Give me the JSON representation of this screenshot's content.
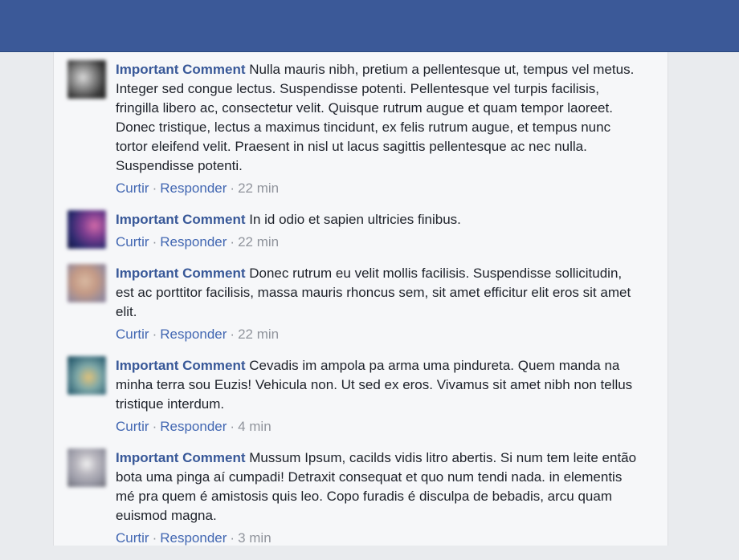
{
  "comments": [
    {
      "author": "Important Comment",
      "text": "Nulla mauris nibh, pretium a pellentesque ut, tempus vel metus. Integer sed congue lectus. Suspendisse potenti. Pellentesque vel turpis facilisis, fringilla libero ac, consectetur velit. Quisque rutrum augue et quam tempor laoreet. Donec tristique, lectus a maximus tincidunt, ex felis rutrum augue, et tempus nunc tortor eleifend velit. Praesent in nisl ut lacus sagittis pellentesque ac nec nulla. Suspendisse potenti.",
      "like_label": "Curtir",
      "reply_label": "Responder",
      "separator": "·",
      "time": "22 min"
    },
    {
      "author": "Important Comment",
      "text": "In id odio et sapien ultricies finibus.",
      "like_label": "Curtir",
      "reply_label": "Responder",
      "separator": "·",
      "time": "22 min"
    },
    {
      "author": "Important Comment",
      "text": "Donec rutrum eu velit mollis facilisis. Suspendisse sollicitudin, est ac porttitor facilisis, massa mauris rhoncus sem, sit amet efficitur elit eros sit amet elit.",
      "like_label": "Curtir",
      "reply_label": "Responder",
      "separator": "·",
      "time": "22 min"
    },
    {
      "author": "Important Comment",
      "text": "Cevadis im ampola pa arma uma pindureta. Quem manda na minha terra sou Euzis! Vehicula non. Ut sed ex eros. Vivamus sit amet nibh non tellus tristique interdum.",
      "like_label": "Curtir",
      "reply_label": "Responder",
      "separator": "·",
      "time": "4 min"
    },
    {
      "author": "Important Comment",
      "text": "Mussum Ipsum, cacilds vidis litro abertis. Si num tem leite então bota uma pinga aí cumpadi! Detraxit consequat et quo num tendi nada. in elementis mé pra quem é amistosis quis leo. Copo furadis é disculpa de bebadis, arcu quam euismod magna.",
      "like_label": "Curtir",
      "reply_label": "Responder",
      "separator": "·",
      "time": "3 min"
    }
  ],
  "colors": {
    "topbar": "#3b5998",
    "author": "#385898",
    "link": "#4267b2",
    "meta": "#90949c",
    "text": "#1d2129"
  }
}
